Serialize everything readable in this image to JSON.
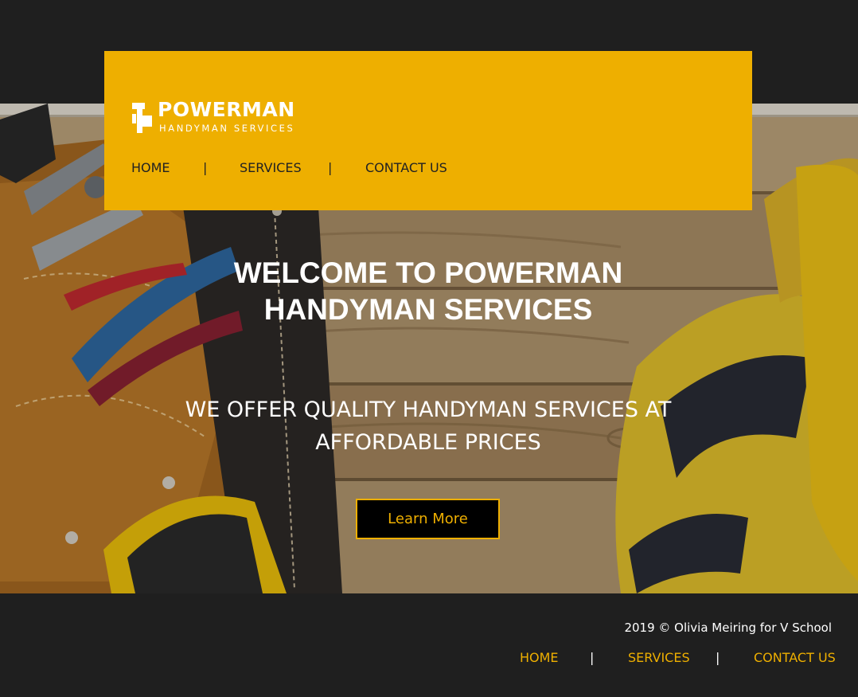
{
  "brand": {
    "title": "POWERMAN",
    "subtitle": "HANDYMAN SERVICES"
  },
  "nav": {
    "items": [
      "HOME",
      "SERVICES",
      "CONTACT US"
    ],
    "separator": "|"
  },
  "hero": {
    "title_line1": "WELCOME TO POWERMAN",
    "title_line2": "HANDYMAN SERVICES",
    "subtitle_line1": "WE OFFER QUALITY HANDYMAN SERVICES AT",
    "subtitle_line2": "AFFORDABLE PRICES",
    "button_label": "Learn More"
  },
  "footer": {
    "credit": "2019 © Olivia Meiring for V School",
    "nav": [
      "HOME",
      "SERVICES",
      "CONTACT US"
    ],
    "separator": "|"
  },
  "colors": {
    "accent": "#eeaf00",
    "background": "#1f1f1f",
    "button_bg": "#000000"
  },
  "icons": [
    "hammer-logo-icon"
  ]
}
